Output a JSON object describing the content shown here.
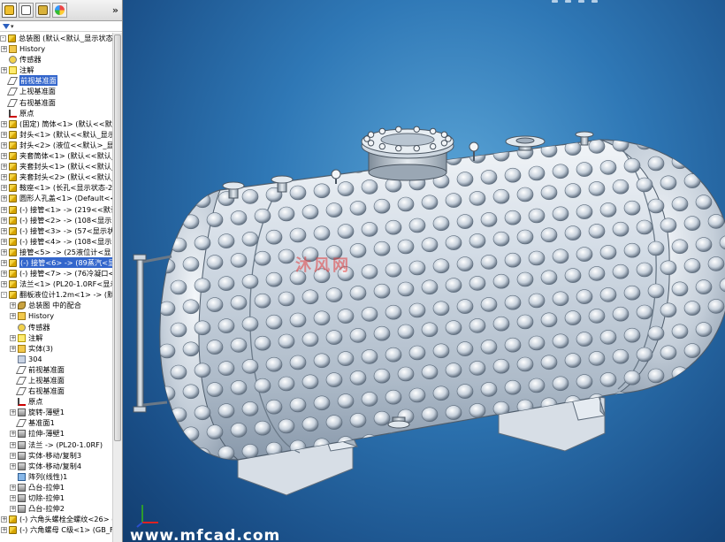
{
  "panel": {
    "tabs": [
      "feature-manager",
      "property-manager",
      "configuration-manager",
      "display-manager"
    ],
    "collapse_glyph": "»"
  },
  "tree": [
    {
      "label": "总装图  (默认<默认_显示状态-1",
      "indent": 0,
      "icon": "part",
      "exp": "-"
    },
    {
      "label": "History",
      "indent": 1,
      "icon": "fold",
      "exp": "+"
    },
    {
      "label": "传感器",
      "indent": 1,
      "icon": "sensor",
      "exp": ""
    },
    {
      "label": "注解",
      "indent": 1,
      "icon": "note",
      "exp": "+"
    },
    {
      "label": "前视基准面",
      "indent": 1,
      "icon": "plane",
      "exp": "",
      "selected": true
    },
    {
      "label": "上视基准面",
      "indent": 1,
      "icon": "plane",
      "exp": ""
    },
    {
      "label": "右视基准面",
      "indent": 1,
      "icon": "plane",
      "exp": ""
    },
    {
      "label": "原点",
      "indent": 1,
      "icon": "origin",
      "exp": ""
    },
    {
      "label": "(固定) 筒体<1> (默认<<默认",
      "indent": 1,
      "icon": "part",
      "exp": "+"
    },
    {
      "label": "封头<1> (默认<<默认_显示状态-2",
      "indent": 1,
      "icon": "part",
      "exp": "+"
    },
    {
      "label": "封头<2> (液位<<默认>_显",
      "indent": 1,
      "icon": "part",
      "exp": "+"
    },
    {
      "label": "夹套筒体<1> (默认<<默认_",
      "indent": 1,
      "icon": "part",
      "exp": "+"
    },
    {
      "label": "夹套封头<1> (默认<<默认_",
      "indent": 1,
      "icon": "part",
      "exp": "+"
    },
    {
      "label": "夹套封头<2> (默认<<默认_",
      "indent": 1,
      "icon": "part",
      "exp": "+"
    },
    {
      "label": "鞍座<1> (长孔<显示状态-2",
      "indent": 1,
      "icon": "part",
      "exp": "+"
    },
    {
      "label": "圆形人孔盖<1> (Default<<",
      "indent": 1,
      "icon": "part",
      "exp": "+"
    },
    {
      "label": "(-) 接管<1> -> (219<<默认",
      "indent": 1,
      "icon": "part",
      "exp": "+"
    },
    {
      "label": "(-) 接管<2> -> (108<显示",
      "indent": 1,
      "icon": "part",
      "exp": "+"
    },
    {
      "label": "(-) 接管<3> -> (57<显示状",
      "indent": 1,
      "icon": "part",
      "exp": "+"
    },
    {
      "label": "(-) 接管<4> -> (108<显示",
      "indent": 1,
      "icon": "part",
      "exp": "+"
    },
    {
      "label": "接管<5> -> (25液位计<显",
      "indent": 1,
      "icon": "part",
      "exp": "+"
    },
    {
      "label": "(-) 接管<6> -> (89蒸汽<显",
      "indent": 1,
      "icon": "part",
      "exp": "+",
      "selected": true
    },
    {
      "label": "(-) 接管<7> -> (76冷凝口<",
      "indent": 1,
      "icon": "part",
      "exp": "+"
    },
    {
      "label": "法兰<1> (PL20-1.0RF<显示",
      "indent": 1,
      "icon": "part",
      "exp": "+"
    },
    {
      "label": "翻板液位计1.2m<1> -> (默",
      "indent": 1,
      "icon": "part",
      "exp": "-"
    },
    {
      "label": "总装图 中的配合",
      "indent": 2,
      "icon": "mate",
      "exp": "+"
    },
    {
      "label": "History",
      "indent": 2,
      "icon": "fold",
      "exp": "+"
    },
    {
      "label": "传感器",
      "indent": 2,
      "icon": "sensor",
      "exp": ""
    },
    {
      "label": "注解",
      "indent": 2,
      "icon": "note",
      "exp": "+"
    },
    {
      "label": "实体(3)",
      "indent": 2,
      "icon": "fold",
      "exp": "+"
    },
    {
      "label": "304",
      "indent": 2,
      "icon": "mat",
      "exp": ""
    },
    {
      "label": "前视基准面",
      "indent": 2,
      "icon": "plane",
      "exp": ""
    },
    {
      "label": "上视基准面",
      "indent": 2,
      "icon": "plane",
      "exp": ""
    },
    {
      "label": "右视基准面",
      "indent": 2,
      "icon": "plane",
      "exp": ""
    },
    {
      "label": "原点",
      "indent": 2,
      "icon": "origin",
      "exp": ""
    },
    {
      "label": "旋转-薄壁1",
      "indent": 2,
      "icon": "feat",
      "exp": "+"
    },
    {
      "label": "基准面1",
      "indent": 2,
      "icon": "plane",
      "exp": ""
    },
    {
      "label": "拉伸-薄壁1",
      "indent": 2,
      "icon": "feat",
      "exp": "+"
    },
    {
      "label": "法兰 -> (PL20-1.0RF)",
      "indent": 2,
      "icon": "feat",
      "exp": "+"
    },
    {
      "label": "实体-移动/复制3",
      "indent": 2,
      "icon": "feat",
      "exp": "+"
    },
    {
      "label": "实体-移动/复制4",
      "indent": 2,
      "icon": "feat",
      "exp": "+"
    },
    {
      "label": "阵列(线性)1",
      "indent": 2,
      "icon": "pat",
      "exp": ""
    },
    {
      "label": "凸台-拉伸1",
      "indent": 2,
      "icon": "feat",
      "exp": "+"
    },
    {
      "label": "切除-拉伸1",
      "indent": 2,
      "icon": "feat",
      "exp": "+"
    },
    {
      "label": "凸台-拉伸2",
      "indent": 2,
      "icon": "feat",
      "exp": "+"
    },
    {
      "label": "(-) 六角头螺栓全螺纹<26> (",
      "indent": 1,
      "icon": "part",
      "exp": "+"
    },
    {
      "label": "(-) 六角螺母 C级<1> (GB_F",
      "indent": 1,
      "icon": "part",
      "exp": "+"
    }
  ],
  "viewport": {
    "watermark": "沐风网",
    "url_watermark": "www.mfcad.com",
    "background_top": "#5aa4d6",
    "background_bottom": "#123d6f"
  }
}
